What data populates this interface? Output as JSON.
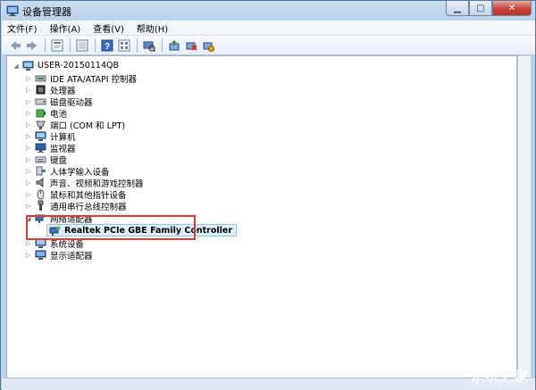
{
  "window": {
    "title": "设备管理器",
    "controls": {
      "minimize": "▁",
      "maximize": "□",
      "close": "✕"
    }
  },
  "menu": [
    {
      "label": "文件(F)"
    },
    {
      "label": "操作(A)"
    },
    {
      "label": "查看(V)"
    },
    {
      "label": "帮助(H)"
    }
  ],
  "toolbar": {
    "buttons": [
      "back-icon",
      "forward-icon",
      "properties-icon",
      "view-icon",
      "help-icon",
      "list-icon",
      "scan-icon",
      "update-driver-icon",
      "disable-icon",
      "uninstall-icon"
    ]
  },
  "tree": {
    "root": "USER-20150114QB",
    "categories": [
      {
        "label": "IDE ATA/ATAPI 控制器",
        "icon": "ide-controller-icon"
      },
      {
        "label": "处理器",
        "icon": "processor-icon"
      },
      {
        "label": "磁盘驱动器",
        "icon": "disk-drive-icon"
      },
      {
        "label": "电池",
        "icon": "battery-icon"
      },
      {
        "label": "端口 (COM 和 LPT)",
        "icon": "port-icon"
      },
      {
        "label": "计算机",
        "icon": "computer-icon"
      },
      {
        "label": "监视器",
        "icon": "monitor-icon"
      },
      {
        "label": "键盘",
        "icon": "keyboard-icon"
      },
      {
        "label": "人体学输入设备",
        "icon": "hid-icon"
      },
      {
        "label": "声音、视频和游戏控制器",
        "icon": "sound-icon"
      },
      {
        "label": "鼠标和其他指针设备",
        "icon": "mouse-icon"
      },
      {
        "label": "通用串行总线控制器",
        "icon": "usb-icon"
      },
      {
        "label": "网络适配器",
        "icon": "network-adapter-icon",
        "expanded": true
      },
      {
        "label": "系统设备",
        "icon": "system-device-icon"
      },
      {
        "label": "显示适配器",
        "icon": "display-adapter-icon"
      }
    ],
    "network_child": "Realtek PCIe GBE Family Controller"
  },
  "watermark": {
    "main": "系统之家",
    "sub": "XITONGZHIJIA.NET"
  },
  "colors": {
    "highlight_border": "#e03a3a",
    "selection_bg": "#dff0fb"
  }
}
